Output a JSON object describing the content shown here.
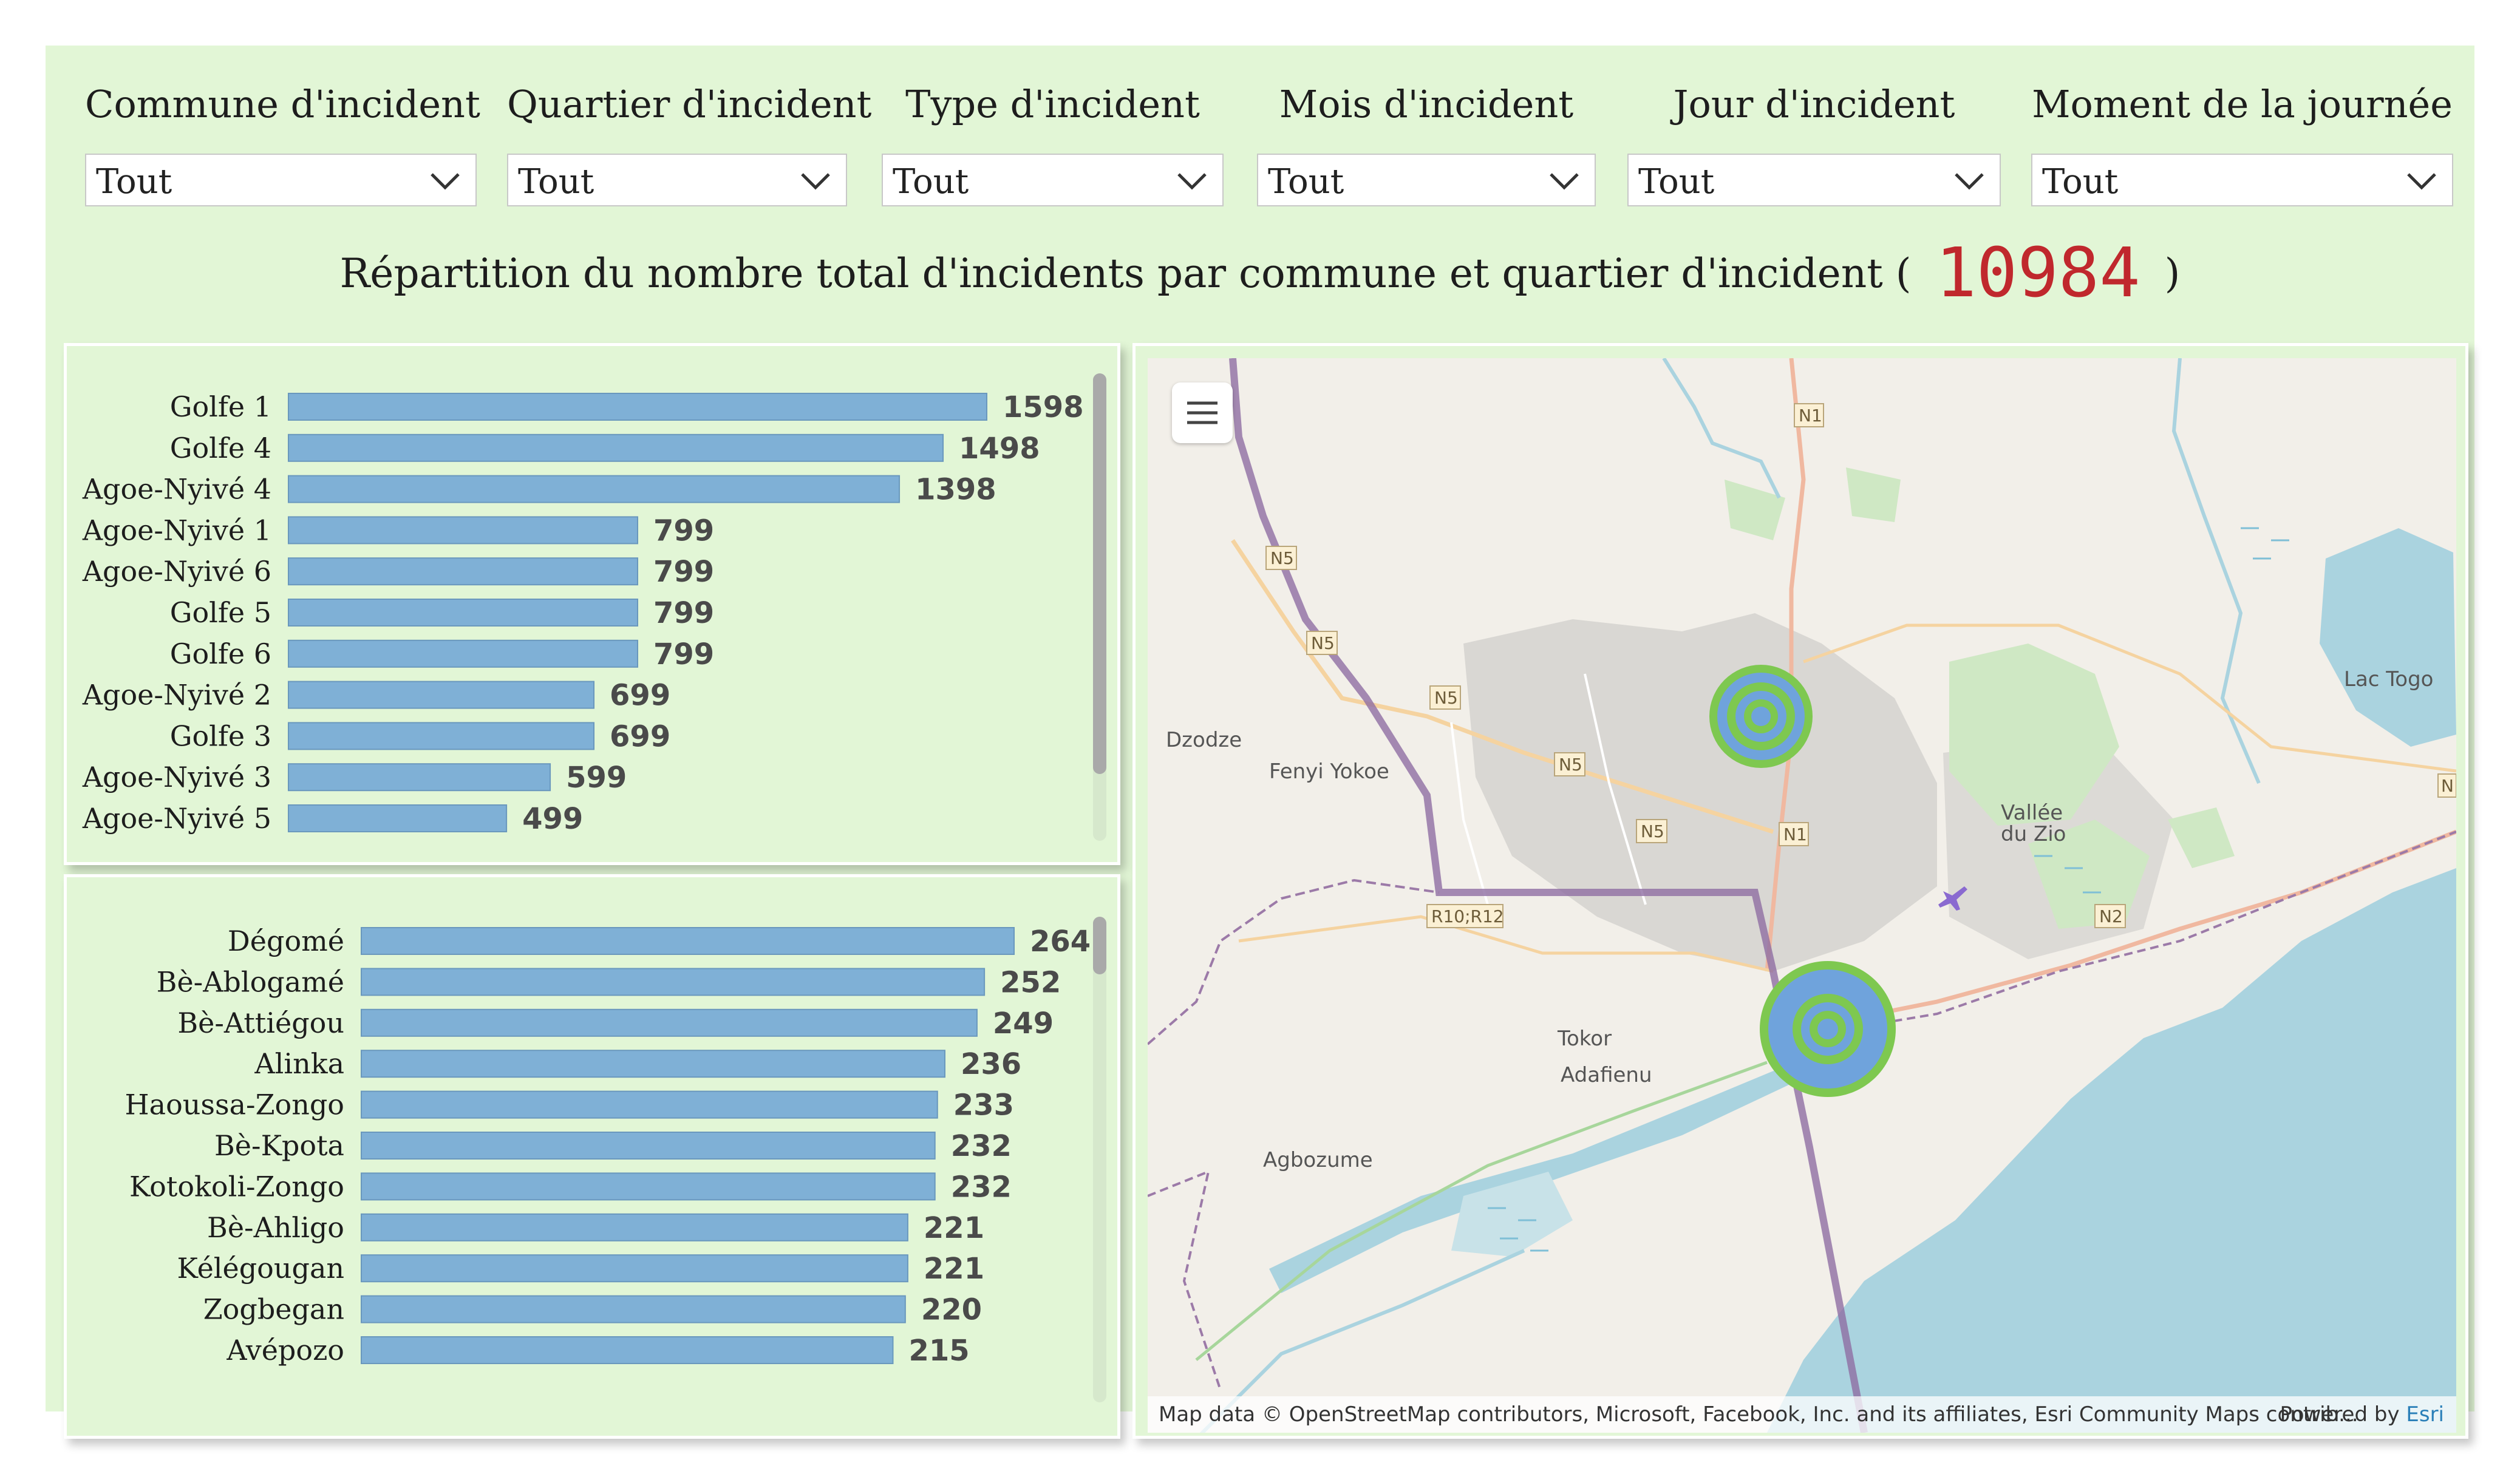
{
  "filters": [
    {
      "label": "Commune d'incident",
      "value": "Tout"
    },
    {
      "label": "Quartier d'incident",
      "value": "Tout"
    },
    {
      "label": "Type d'incident",
      "value": "Tout"
    },
    {
      "label": "Mois d'incident",
      "value": "Tout"
    },
    {
      "label": "Jour d'incident",
      "value": "Tout"
    },
    {
      "label": "Moment de la journée",
      "value": "Tout"
    }
  ],
  "title": {
    "text": "Répartition du nombre total d'incidents par commune et quartier d'incident (",
    "total": "10984",
    "close": ")"
  },
  "colors": {
    "background": "#e2f6d6",
    "bar": "#7fb0d6",
    "kpi": "#c0282d"
  },
  "chart_data": [
    {
      "type": "bar",
      "orientation": "horizontal",
      "categories": [
        "Golfe 1",
        "Golfe 4",
        "Agoe-Nyivé 4",
        "Agoe-Nyivé 1",
        "Agoe-Nyivé 6",
        "Golfe 5",
        "Golfe 6",
        "Agoe-Nyivé 2",
        "Golfe 3",
        "Agoe-Nyivé 3",
        "Agoe-Nyivé 5"
      ],
      "values": [
        1598,
        1498,
        1398,
        799,
        799,
        799,
        799,
        699,
        699,
        599,
        499
      ],
      "data_labels": true,
      "grid": false
    },
    {
      "type": "bar",
      "orientation": "horizontal",
      "categories": [
        "Dégomé",
        "Bè-Ablogamé",
        "Bè-Attiégou",
        "Alinka",
        "Haoussa-Zongo",
        "Bè-Kpota",
        "Kotokoli-Zongo",
        "Bè-Ahligo",
        "Kélégougan",
        "Zogbegan",
        "Avépozo"
      ],
      "values": [
        264,
        252,
        249,
        236,
        233,
        232,
        232,
        221,
        221,
        220,
        215
      ],
      "data_labels": true,
      "grid": false
    }
  ],
  "map": {
    "place_labels": [
      "Dzodze",
      "Fenyi Yokoe",
      "Tokor",
      "Adafienu",
      "Agbozume",
      "Lac Togo",
      "Vallée",
      "du Zio"
    ],
    "road_labels": [
      "N1",
      "N5",
      "N5",
      "N5",
      "N5",
      "N5",
      "N1",
      "R10;R12",
      "N2",
      "N"
    ],
    "attribution": "Map data © OpenStreetMap contributors, Microsoft, Facebook, Inc. and its affiliates, Esri Community Maps contrib...",
    "powered_by": "Powered by",
    "powered_brand": "Esri"
  }
}
